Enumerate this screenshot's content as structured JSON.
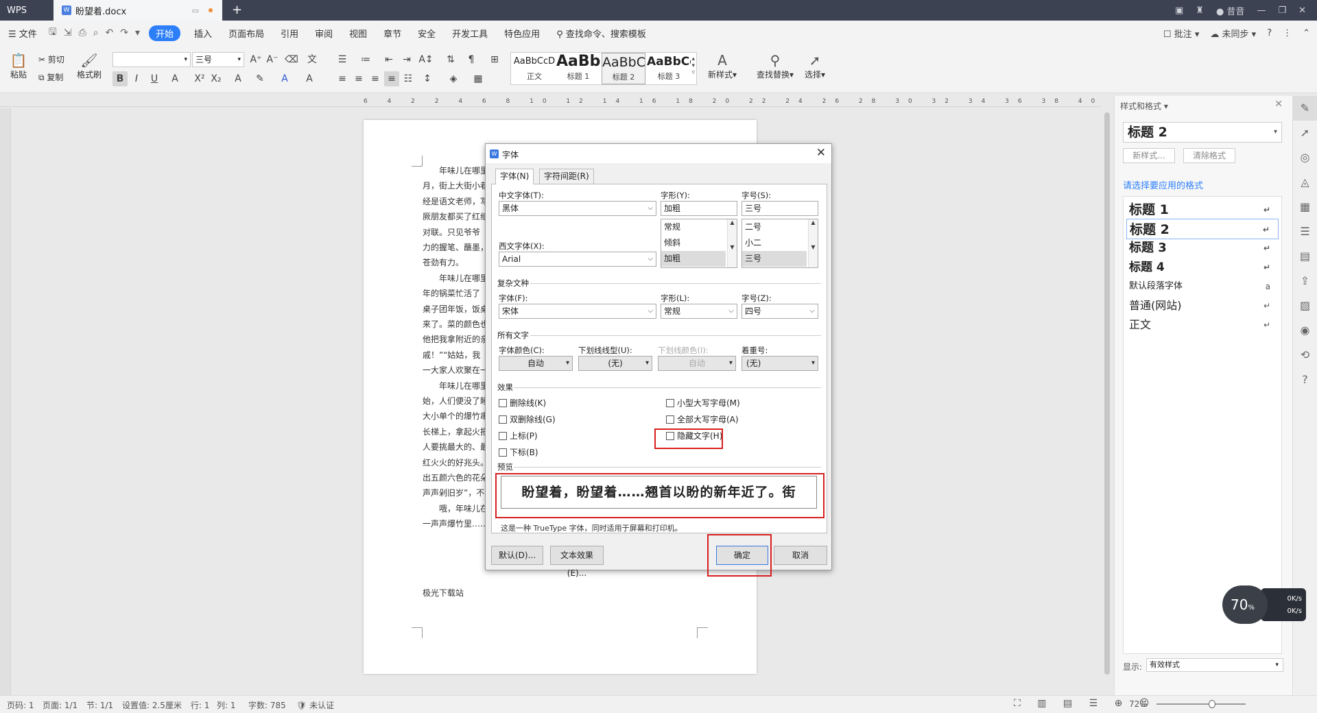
{
  "titlebar": {
    "app_label": "WPS",
    "doc_tab": "盼望着.docx",
    "new_tab": "+",
    "user": "昔音"
  },
  "menubar": {
    "file": "文件",
    "tabs": [
      "开始",
      "插入",
      "页面布局",
      "引用",
      "审阅",
      "视图",
      "章节",
      "安全",
      "开发工具",
      "特色应用"
    ],
    "active_tab": "开始",
    "search": "查找命令、搜索模板",
    "right": [
      "批注",
      "未同步"
    ]
  },
  "ribbon": {
    "paste": "粘贴",
    "cut": "剪切",
    "copy": "复制",
    "format_painter": "格式刷",
    "font_size": "三号",
    "styles": [
      {
        "preview": "AaBbCcD",
        "name": "正文"
      },
      {
        "preview": "AaBb",
        "name": "标题 1"
      },
      {
        "preview": "AaBbC",
        "name": "标题 2"
      },
      {
        "preview": "AaBbCc",
        "name": "标题 3"
      }
    ],
    "new_style": "新样式",
    "find_replace": "查找替换",
    "select": "选择"
  },
  "ruler_marks": "6 4 2   2 4 6 8 10 12 14 16 18 20 22 24 26 28 30 32 34 36 38 40",
  "document": {
    "lines": [
      "年味儿在哪里",
      "月，街上大街小巷",
      "经是语文老师，写",
      "厥朋友都买了红纸",
      "对联。只见爷爷",
      "力的握笔、蘸墨，",
      "苍劲有力。",
      "年味儿在哪里",
      "年的锅菜忙活了",
      "桌子团年饭，饭桌",
      "来了。菜的颜色也",
      "他把我拿附近的亲",
      "戚！”“姑姑，我",
      "一大家人欢聚在一",
      "年味儿在哪里",
      "始，人们便没了睡",
      "大小单个的爆竹串",
      "长梯上，拿起火把",
      "人要挑最大的、最",
      "红火火的好兆头。",
      "出五颜六色的花朵",
      "声声剁旧岁”，不错",
      "哦，年味儿在",
      "一声声爆竹里……"
    ],
    "footer_text": "极光下载站"
  },
  "style_panel": {
    "header": "样式和格式",
    "current": "标题 2",
    "new_style_btn": "新样式...",
    "clear_btn": "清除格式",
    "prompt": "请选择要应用的格式",
    "items": [
      "标题 1",
      "标题 2",
      "标题 3",
      "标题 4",
      "默认段落字体",
      "普通(网站)",
      "正文"
    ],
    "show_label": "显示:",
    "show_value": "有效样式"
  },
  "network": {
    "percent": "70",
    "unit": "%",
    "up": "0K/s",
    "down": "0K/s"
  },
  "statusbar": {
    "page": "页码: 1",
    "pages": "页面: 1/1",
    "section": "节: 1/1",
    "setting": "设置值: 2.5厘米",
    "row": "行: 1",
    "col": "列: 1",
    "words": "字数: 785",
    "cert": "未认证",
    "zoom": "72%"
  },
  "dialog": {
    "title": "字体",
    "tabs": [
      "字体(N)",
      "字符间距(R)"
    ],
    "cn_font_label": "中文字体(T):",
    "cn_font": "黑体",
    "style_label": "字形(Y):",
    "style_value": "加粗",
    "style_list": [
      "常规",
      "倾斜",
      "加粗"
    ],
    "size_label": "字号(S):",
    "size_value": "三号",
    "size_list": [
      "二号",
      "小二",
      "三号"
    ],
    "west_font_label": "西文字体(X):",
    "west_font": "Arial",
    "complex_group": "复杂文种",
    "complex_font_label": "字体(F):",
    "complex_font": "宋体",
    "complex_style_label": "字形(L):",
    "complex_style": "常规",
    "complex_size_label": "字号(Z):",
    "complex_size": "四号",
    "all_text_group": "所有文字",
    "color_label": "字体颜色(C):",
    "color_value": "自动",
    "underline_label": "下划线线型(U):",
    "underline_value": "(无)",
    "underline_color_label": "下划线颜色(I):",
    "underline_color_value": "自动",
    "emphasis_label": "着重号:",
    "emphasis_value": "(无)",
    "effects_group": "效果",
    "effects_left": [
      "删除线(K)",
      "双删除线(G)",
      "上标(P)",
      "下标(B)"
    ],
    "effects_right": [
      "小型大写字母(M)",
      "全部大写字母(A)",
      "隐藏文字(H)"
    ],
    "preview_group": "预览",
    "preview_text": "盼望着，盼望着……翘首以盼的新年近了。街",
    "note": "这是一种 TrueType 字体，同时适用于屏幕和打印机。",
    "btn_default": "默认(D)...",
    "btn_text_effect": "文本效果(E)...",
    "btn_ok": "确定",
    "btn_cancel": "取消"
  },
  "colors": {
    "accent": "#2d7ff9",
    "highlight_box": "#d81e1e",
    "titlebar": "#3c4252"
  }
}
